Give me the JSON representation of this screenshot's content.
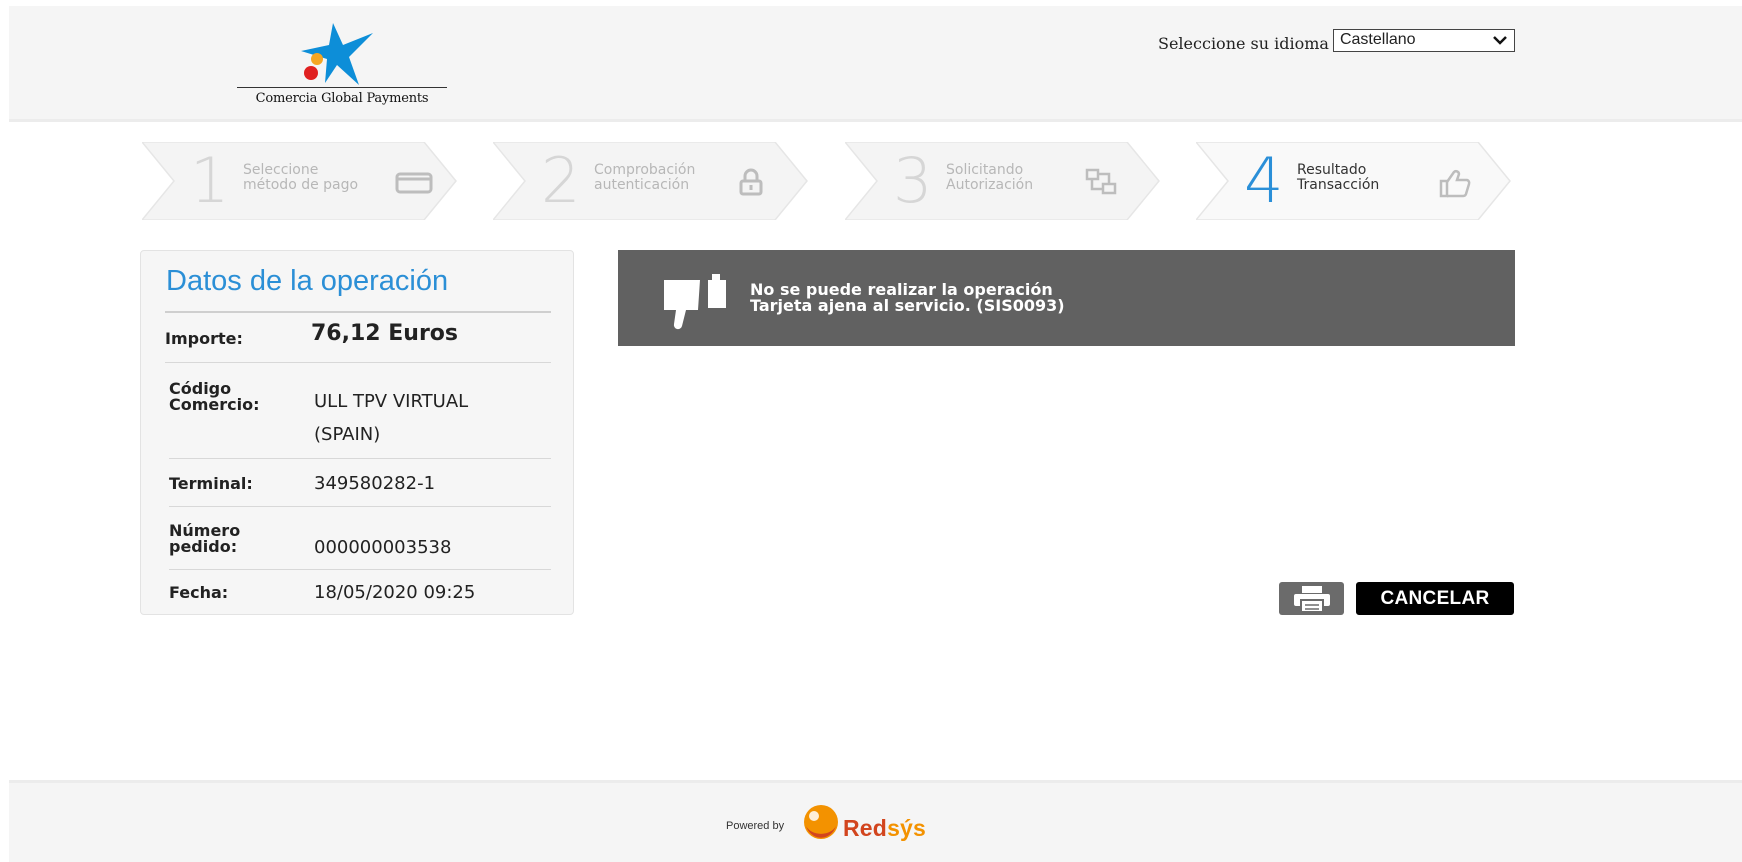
{
  "header": {
    "brand": "Comercia Global Payments",
    "language_label": "Seleccione su idioma",
    "language_value": "Castellano"
  },
  "steps": [
    {
      "number": "1",
      "line1": "Seleccione",
      "line2": "método de pago",
      "icon": "credit-card-icon",
      "active": false
    },
    {
      "number": "2",
      "line1": "Comprobación",
      "line2": "autenticación",
      "icon": "lock-icon",
      "active": false
    },
    {
      "number": "3",
      "line1": "Solicitando",
      "line2": "Autorización",
      "icon": "network-icon",
      "active": false
    },
    {
      "number": "4",
      "line1": "Resultado",
      "line2": "Transacción",
      "icon": "thumbs-up-icon",
      "active": true
    }
  ],
  "operation": {
    "title": "Datos de la operación",
    "amount_label": "Importe:",
    "amount_value": "76,12  Euros",
    "merchant_label_1": "Código",
    "merchant_label_2": "Comercio:",
    "merchant_value_1": "ULL TPV VIRTUAL",
    "merchant_value_2": "(SPAIN)",
    "terminal_label": "Terminal:",
    "terminal_value": "349580282-1",
    "order_label_1": "Número",
    "order_label_2": "pedido:",
    "order_value": "000000003538",
    "date_label": "Fecha:",
    "date_value": "18/05/2020  09:25"
  },
  "error": {
    "title": "No se puede realizar la operación",
    "detail": "Tarjeta ajena al servicio. (SIS0093)",
    "icon": "thumbs-down-icon"
  },
  "actions": {
    "print_icon": "printer-icon",
    "cancel_label": "CANCELAR"
  },
  "footer": {
    "powered_by": "Powered by",
    "brand_red": "Red",
    "brand_sys": "sýs"
  },
  "colors": {
    "accent_blue": "#2b8fd6",
    "error_bg": "#616161",
    "redsys_red": "#d2451e",
    "redsys_orange": "#f39200"
  }
}
